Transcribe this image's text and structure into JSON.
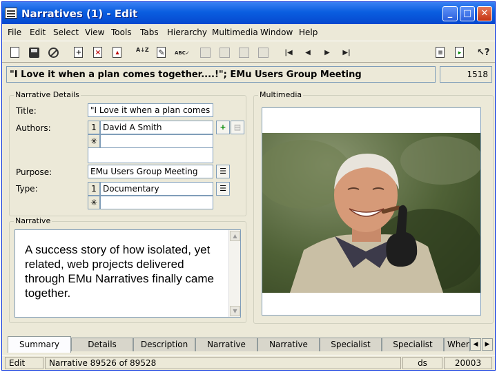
{
  "window": {
    "title": "Narratives (1) - Edit",
    "controls": {
      "minimize": "_",
      "maximize": "□",
      "close": "✕"
    }
  },
  "menu": [
    "File",
    "Edit",
    "Select",
    "View",
    "Tools",
    "Tabs",
    "Hierarchy",
    "Multimedia",
    "Window",
    "Help"
  ],
  "toolbar": {
    "icons": [
      "new-icon",
      "save-icon",
      "cancel-icon",
      "copy-record-icon",
      "delete-record-icon",
      "paste-record-icon",
      "sort-icon",
      "edit-icon",
      "spellcheck-icon",
      "view-icon",
      "table-icon",
      "page-icon",
      "image-icon",
      "first-icon",
      "prev-icon",
      "next-icon",
      "last-icon",
      "report-icon",
      "export-icon",
      "help-pointer-icon"
    ],
    "sort_glyph": "A↓Z",
    "spell_glyph": "ABC✓"
  },
  "record": {
    "summary": "\"I Love it when a plan comes together....!\"; EMu Users Group Meeting",
    "irn": "1518"
  },
  "details": {
    "group_label": "Narrative Details",
    "title_label": "Title:",
    "title_value": "\"I Love it when a plan comes together",
    "authors_label": "Authors:",
    "authors_row_num": "1",
    "authors_value": "David A Smith",
    "new_row_marker": "✳",
    "purpose_label": "Purpose:",
    "purpose_value": "EMu Users Group Meeting",
    "type_label": "Type:",
    "type_row_num": "1",
    "type_value": "Documentary"
  },
  "narrative": {
    "group_label": "Narrative",
    "text": "A success story of how isolated, yet related, web projects delivered through EMu Narratives finally came together."
  },
  "multimedia": {
    "group_label": "Multimedia"
  },
  "tabs": [
    "Summary",
    "Details",
    "Description",
    "Narrative",
    "Narrative",
    "Specialist",
    "Specialist",
    "Where"
  ],
  "active_tab": "Summary",
  "status": {
    "mode": "Edit",
    "position": "Narrative 89526 of 89528",
    "user": "ds",
    "code": "20003"
  }
}
